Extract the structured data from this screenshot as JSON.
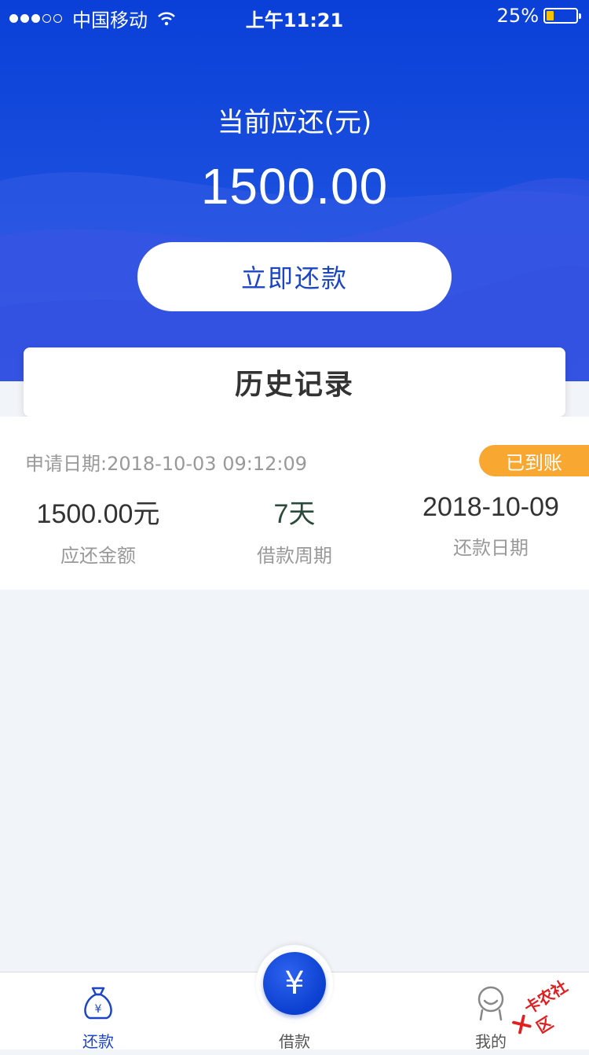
{
  "status_bar": {
    "carrier": "中国移动",
    "time": "上午11:21",
    "battery_percent_text": "25%",
    "battery_level": 0.25
  },
  "summary": {
    "due_label": "当前应还(元)",
    "due_amount": "1500.00",
    "repay_button": "立即还款"
  },
  "history": {
    "title": "历史记录"
  },
  "record": {
    "apply_date": "申请日期:2018-10-03 09:12:09",
    "status": "已到账",
    "amount_value": "1500.00元",
    "amount_label": "应还金额",
    "period_value": "7天",
    "period_label": "借款周期",
    "due_date_value": "2018-10-09",
    "due_date_label": "还款日期"
  },
  "tabbar": {
    "tabs": [
      {
        "label": "还款",
        "icon": "money-bag-icon",
        "active": true
      },
      {
        "label": "借款",
        "icon": "yen-circle-icon",
        "active": false
      },
      {
        "label": "我的",
        "icon": "user-face-icon",
        "active": false
      }
    ]
  },
  "watermark": "卡农社区",
  "colors": {
    "primary_blue": "#0a40d8",
    "accent_blue": "#1c45c6",
    "badge_orange": "#f8a830",
    "background": "#f1f4f8"
  }
}
